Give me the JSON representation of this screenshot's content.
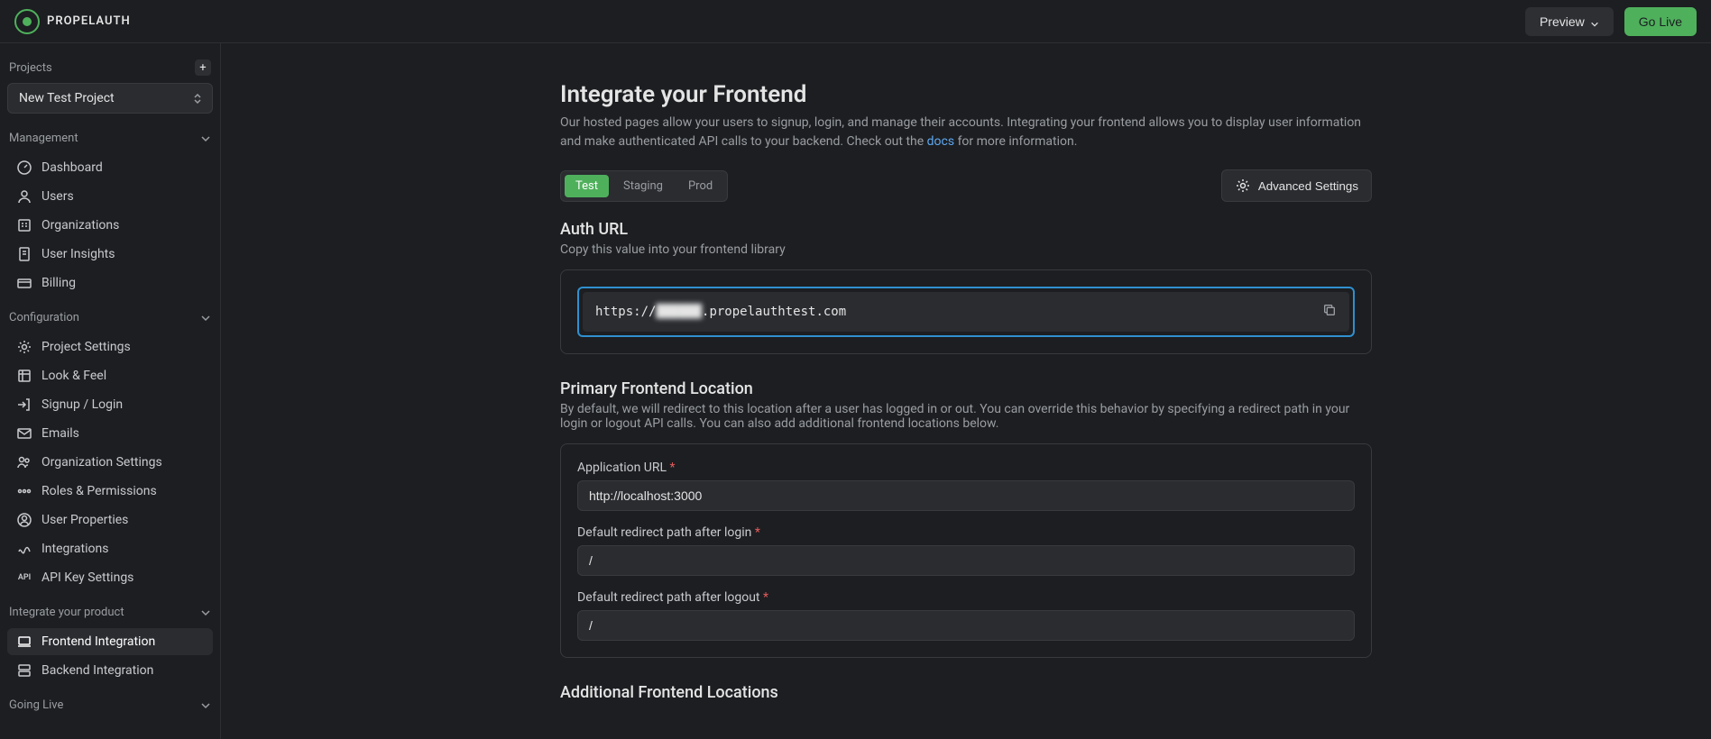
{
  "header": {
    "brand": "PROPELAUTH",
    "preview_btn": "Preview",
    "go_live_btn": "Go Live"
  },
  "sidebar": {
    "projects_label": "Projects",
    "current_project": "New Test Project",
    "sections": {
      "management": {
        "title": "Management",
        "items": [
          {
            "label": "Dashboard",
            "icon": "dashboard-icon"
          },
          {
            "label": "Users",
            "icon": "users-icon"
          },
          {
            "label": "Organizations",
            "icon": "organizations-icon"
          },
          {
            "label": "User Insights",
            "icon": "insights-icon"
          },
          {
            "label": "Billing",
            "icon": "billing-icon"
          }
        ]
      },
      "configuration": {
        "title": "Configuration",
        "items": [
          {
            "label": "Project Settings",
            "icon": "gear-icon"
          },
          {
            "label": "Look & Feel",
            "icon": "palette-icon"
          },
          {
            "label": "Signup / Login",
            "icon": "login-icon"
          },
          {
            "label": "Emails",
            "icon": "mail-icon"
          },
          {
            "label": "Organization Settings",
            "icon": "org-settings-icon"
          },
          {
            "label": "Roles & Permissions",
            "icon": "roles-icon"
          },
          {
            "label": "User Properties",
            "icon": "user-props-icon"
          },
          {
            "label": "Integrations",
            "icon": "integrations-icon"
          },
          {
            "label": "API Key Settings",
            "icon": "api-icon",
            "icon_text": "API"
          }
        ]
      },
      "integrate": {
        "title": "Integrate your product",
        "items": [
          {
            "label": "Frontend Integration",
            "icon": "laptop-icon",
            "active": true
          },
          {
            "label": "Backend Integration",
            "icon": "server-icon"
          }
        ]
      },
      "going_live": {
        "title": "Going Live"
      }
    }
  },
  "main": {
    "title": "Integrate your Frontend",
    "description_pre": "Our hosted pages allow your users to signup, login, and manage their accounts. Integrating your frontend allows you to display user information and make authenticated API calls to your backend. Check out the ",
    "docs_link": "docs",
    "description_post": " for more information.",
    "env_tabs": [
      "Test",
      "Staging",
      "Prod"
    ],
    "advanced_settings": "Advanced Settings",
    "auth_url": {
      "title": "Auth URL",
      "desc": "Copy this value into your frontend library",
      "url_prefix": "https://",
      "url_blurred": "██████",
      "url_suffix": ".propelauthtest.com"
    },
    "primary_location": {
      "title": "Primary Frontend Location",
      "desc": "By default, we will redirect to this location after a user has logged in or out. You can override this behavior by specifying a redirect path in your login or logout API calls. You can also add additional frontend locations below.",
      "app_url_label": "Application URL",
      "app_url_value": "http://localhost:3000",
      "login_redirect_label": "Default redirect path after login",
      "login_redirect_value": "/",
      "logout_redirect_label": "Default redirect path after logout",
      "logout_redirect_value": "/"
    },
    "additional_locations_title": "Additional Frontend Locations"
  }
}
